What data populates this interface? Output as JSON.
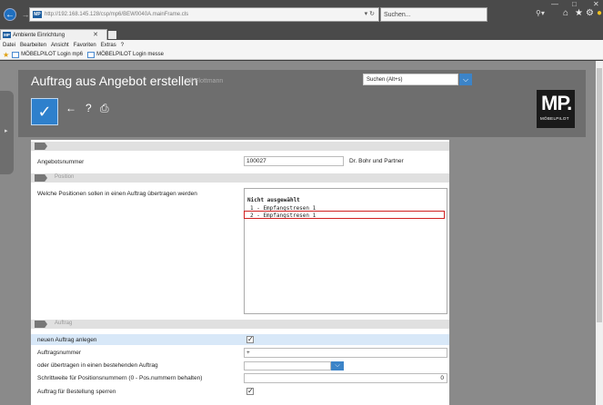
{
  "browser": {
    "url": "http://192.168.145.128/csp/mp6/BEW0040A.mainFrame.cls",
    "search_placeholder": "Suchen...",
    "tab_title": "Ambiente Einrichtung",
    "menu": [
      "Datei",
      "Bearbeiten",
      "Ansicht",
      "Favoriten",
      "Extras",
      "?"
    ],
    "favorites": [
      "MÖBELPILOT Login mp6",
      "MÖBELPILOT Login messe"
    ]
  },
  "header": {
    "title": "Auftrag aus Angebot erstellen",
    "user": "Uli Flottmann",
    "search_value": "Suchen (Alt+s)",
    "logo_main": "MP.",
    "logo_sub": "MÖBELPILOT"
  },
  "form": {
    "angebot_label": "Angebotsnummer",
    "angebot_value": "100027",
    "partner": "Dr. Bohr und Partner",
    "section_position": "Position",
    "positions_label": "Welche Positionen sollen in einen Auftrag übertragen werden",
    "list_header": "Nicht ausgewählt",
    "list_items": [
      "1 - Empfangstresen 1",
      "2 - Empfangstresen 1"
    ],
    "section_auftrag": "Auftrag",
    "new_order_label": "neuen Auftrag anlegen",
    "order_no_label": "Auftragsnummer",
    "order_no_value": "+",
    "existing_order_label": "oder übertragen in einen bestehenden Auftrag",
    "step_label": "Schrittweite für Positionsnummern (0 - Pos.nummern behalten)",
    "step_value": "0",
    "lock_label": "Auftrag für Bestellung sperren"
  }
}
